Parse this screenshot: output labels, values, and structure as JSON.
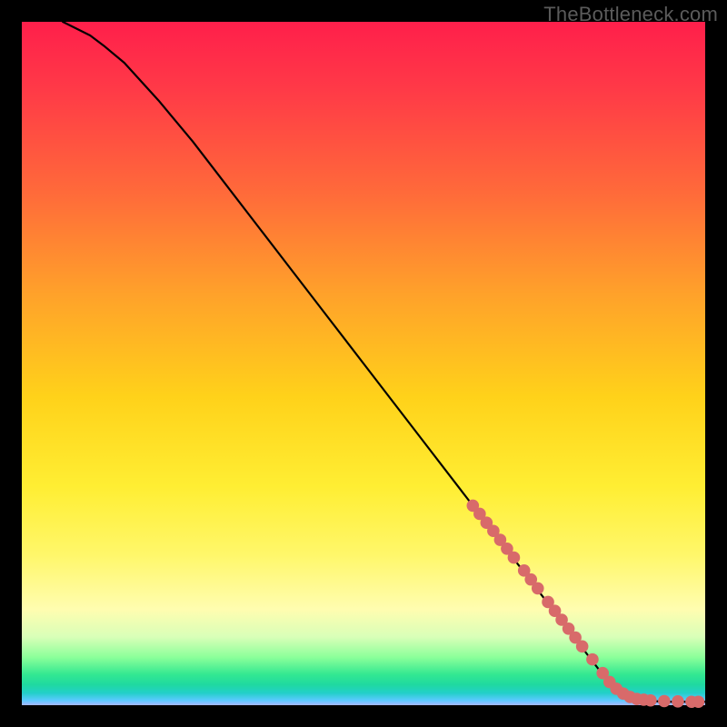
{
  "watermark": "TheBottleneck.com",
  "chart_data": {
    "type": "line",
    "title": "",
    "xlabel": "",
    "ylabel": "",
    "xlim": [
      0,
      100
    ],
    "ylim": [
      0,
      100
    ],
    "grid": false,
    "legend": false,
    "series": [
      {
        "name": "curve",
        "x": [
          6,
          8,
          10,
          12,
          15,
          20,
          25,
          30,
          35,
          40,
          45,
          50,
          55,
          60,
          65,
          70,
          75,
          80,
          85,
          88,
          90,
          92,
          95,
          100
        ],
        "y": [
          100,
          99,
          98,
          96.5,
          94,
          88.5,
          82.5,
          76,
          69.5,
          63,
          56.5,
          50,
          43.5,
          37,
          30.5,
          24,
          17.5,
          11,
          4.5,
          1.8,
          0.9,
          0.6,
          0.5,
          0.5
        ]
      }
    ],
    "points": {
      "name": "salmon-dots",
      "color": "#d86a6a",
      "x": [
        66,
        67,
        68,
        69,
        70,
        71,
        72,
        73.5,
        74.5,
        75.5,
        77,
        78,
        79,
        80,
        81,
        82,
        83.5,
        85,
        86,
        87,
        88,
        89,
        90,
        91,
        92,
        94,
        96,
        98,
        99
      ],
      "y": [
        29.2,
        28,
        26.7,
        25.5,
        24.2,
        22.9,
        21.6,
        19.7,
        18.4,
        17.1,
        15.1,
        13.8,
        12.5,
        11.2,
        9.9,
        8.6,
        6.7,
        4.7,
        3.4,
        2.4,
        1.7,
        1.2,
        0.9,
        0.8,
        0.7,
        0.6,
        0.55,
        0.5,
        0.5
      ]
    }
  }
}
